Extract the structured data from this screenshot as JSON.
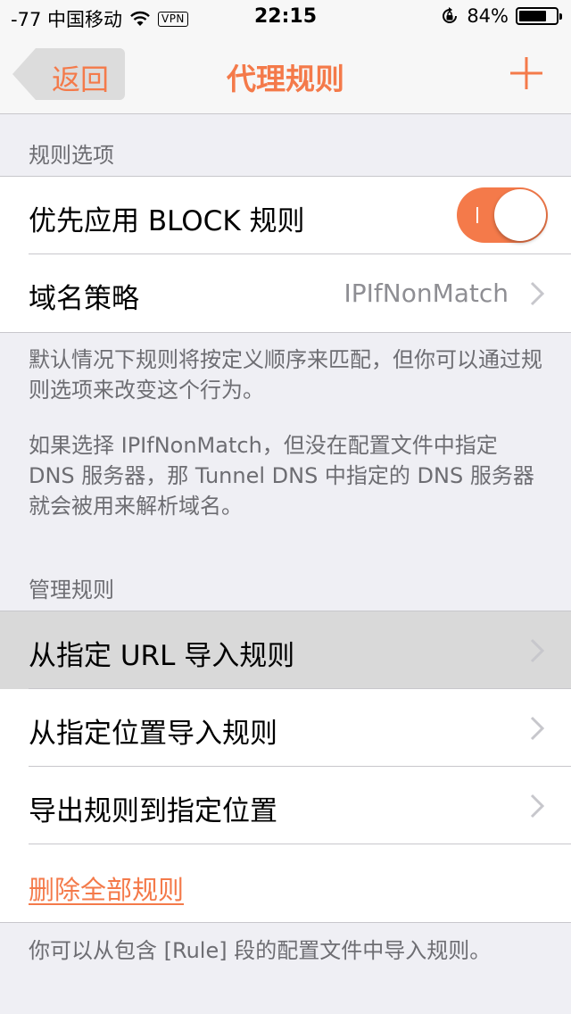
{
  "status_bar": {
    "carrier": "-77 中国移动",
    "vpn": "VPN",
    "time": "22:15",
    "battery_pct": "84%",
    "battery_level": 0.84
  },
  "nav": {
    "back_label": "返回",
    "title": "代理规则",
    "add_icon": "plus-icon"
  },
  "rule_options": {
    "header": "规则选项",
    "items": [
      {
        "label": "优先应用 BLOCK 规则",
        "toggle_on": true
      },
      {
        "label": "域名策略",
        "value": "IPIfNonMatch"
      }
    ],
    "footer_p1": "默认情况下规则将按定义顺序来匹配，但你可以通过规则选项来改变这个行为。",
    "footer_p2": "如果选择 IPIfNonMatch，但没在配置文件中指定 DNS 服务器，那 Tunnel DNS 中指定的 DNS 服务器就会被用来解析域名。"
  },
  "manage_rules": {
    "header": "管理规则",
    "items": [
      {
        "label": "从指定 URL 导入规则"
      },
      {
        "label": "从指定位置导入规则"
      },
      {
        "label": "导出规则到指定位置"
      },
      {
        "label": "删除全部规则"
      }
    ],
    "footer": "你可以从包含 [Rule] 段的配置文件中导入规则。"
  },
  "colors": {
    "accent": "#f47a4a",
    "background": "#efeff4",
    "highlight": "#d9d9d9"
  }
}
